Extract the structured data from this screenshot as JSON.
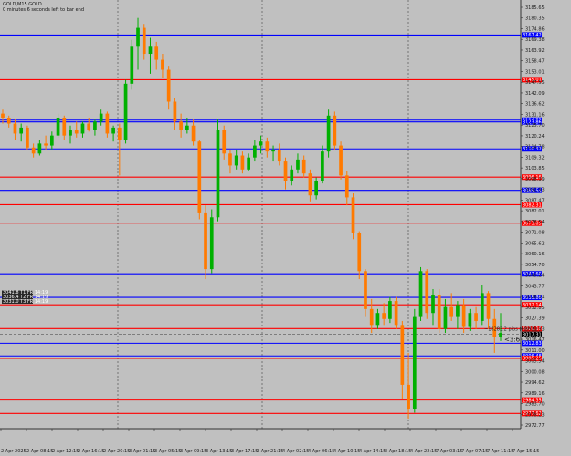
{
  "window": {
    "symbol_header": "GOLD,M15  GOLD",
    "timer_text": "0 minutes 6 seconds left to bar end"
  },
  "chart_data": {
    "type": "candlestick",
    "symbol": "GOLD",
    "timeframe": "M15",
    "ylim": [
      2970,
      3185
    ],
    "y_ticks": [
      3180.65,
      3172.9,
      3164.78,
      3156.57,
      3148.3,
      3139.9,
      3131.71,
      3122.22,
      3116.71,
      3111.25,
      3105.79,
      3100.3,
      3094.95,
      3089.46,
      3083.95,
      3078.49,
      3073.04,
      3067.57,
      3062.07,
      3056.58,
      3051.12,
      3045.61,
      3040.27,
      3034.73,
      3029.27,
      3023.89,
      3018.4,
      3012.92,
      3007.46,
      3001.98,
      2996.59,
      2991.11,
      2985.61,
      2979.75
    ],
    "y_tick_labels": [
      "3185.65",
      "3180.35",
      "3174.86",
      "3169.38",
      "3163.92",
      "3158.47",
      "3153.01",
      "3147.55",
      "3142.09",
      "3136.62",
      "3131.16",
      "3125.70",
      "3120.24",
      "3114.78",
      "3109.32",
      "3103.85",
      "3098.39",
      "3092.93",
      "3087.47",
      "3082.01",
      "3076.54",
      "3071.08",
      "3065.62",
      "3060.16",
      "3054.70",
      "3049.24",
      "3043.77",
      "3038.31",
      "3032.85",
      "3027.39",
      "3021.93",
      "3016.47",
      "3011.00",
      "3005.54",
      "3000.08",
      "2994.62",
      "2989.16",
      "2983.70",
      "2978.23",
      "2972.77"
    ],
    "x_tick_labels": [
      "2 Apr 2025",
      "2 Apr 08:15",
      "2 Apr 12:15",
      "2 Apr 16:15",
      "2 Apr 20:15",
      "3 Apr 01:15",
      "3 Apr 05:15",
      "3 Apr 09:15",
      "3 Apr 13:15",
      "3 Apr 17:15",
      "3 Apr 21:15",
      "4 Apr 02:15",
      "4 Apr 06:15",
      "4 Apr 10:15",
      "4 Apr 14:15",
      "4 Apr 18:15",
      "4 Apr 22:15",
      "7 Apr 03:15",
      "7 Apr 07:15",
      "7 Apr 11:15",
      "7 Apr 15:15"
    ],
    "period_separators": [
      "3 Apr 00:00",
      "4 Apr 00:00",
      "7 Apr 00:00"
    ],
    "levels": [
      {
        "price": 3167.42,
        "color": "#0000ff",
        "label": "3167.42"
      },
      {
        "price": 3145.01,
        "color": "#ff0000",
        "label": "3145.01"
      },
      {
        "price": 3124.73,
        "color": "#0000ff",
        "label": "3124.73"
      },
      {
        "price": 3123.86,
        "color": "#0000ff",
        "label": "3123.86"
      },
      {
        "price": 3110.32,
        "color": "#0000ff",
        "label": "3110.32"
      },
      {
        "price": 3096.16,
        "color": "#ff0000",
        "label": "3096.16"
      },
      {
        "price": 3089.54,
        "color": "#0000ff",
        "label": "3089.54"
      },
      {
        "price": 3082.31,
        "color": "#ff0000",
        "label": "3082.31"
      },
      {
        "price": 3073.05,
        "color": "#ff0000",
        "label": "3073.05"
      },
      {
        "price": 3047.66,
        "color": "#0000ff",
        "label": "3047.66"
      },
      {
        "price": 3035.86,
        "color": "#0000ff",
        "label": "3035.86"
      },
      {
        "price": 3032.14,
        "color": "#ff0000",
        "label": "3032.14"
      },
      {
        "price": 3020.16,
        "color": "#ff0000",
        "label": "3020.16"
      },
      {
        "price": 3012.83,
        "color": "#0000ff",
        "label": "3012.83"
      },
      {
        "price": 3006.48,
        "color": "#0000ff",
        "label": "3006.48"
      },
      {
        "price": 3005.25,
        "color": "#ff0000",
        "label": "3005.25"
      },
      {
        "price": 2984.35,
        "color": "#ff0000",
        "label": "2984.35"
      },
      {
        "price": 2977.62,
        "color": "#ff0000",
        "label": "2977.62"
      }
    ],
    "current_price": {
      "price": 3017.31,
      "label": "3017.31"
    },
    "price_line_annotation": "~18283.2 pips (68.5%)",
    "cursor_label": "<3:6",
    "left_tags": [
      "3041.8 T1 FR 14:19",
      "3036.4 T2 FR 14:19",
      "3031.0 T3 FR 14:19"
    ],
    "colors": {
      "background": "#c0c0c0",
      "bull": "#00b000",
      "bear": "#ff7a00",
      "wick": "#333333",
      "grid": "#808080"
    },
    "candles": [
      {
        "t": 0,
        "o": 3128,
        "h": 3130,
        "l": 3123,
        "c": 3126
      },
      {
        "t": 1,
        "o": 3126,
        "h": 3127,
        "l": 3121,
        "c": 3123
      },
      {
        "t": 2,
        "o": 3123,
        "h": 3125,
        "l": 3115,
        "c": 3118
      },
      {
        "t": 3,
        "o": 3118,
        "h": 3123,
        "l": 3114,
        "c": 3121
      },
      {
        "t": 4,
        "o": 3121,
        "h": 3122,
        "l": 3110,
        "c": 3111
      },
      {
        "t": 5,
        "o": 3111,
        "h": 3113,
        "l": 3106,
        "c": 3108
      },
      {
        "t": 6,
        "o": 3108,
        "h": 3115,
        "l": 3107,
        "c": 3113
      },
      {
        "t": 7,
        "o": 3113,
        "h": 3117,
        "l": 3110,
        "c": 3112
      },
      {
        "t": 8,
        "o": 3112,
        "h": 3119,
        "l": 3110,
        "c": 3117
      },
      {
        "t": 9,
        "o": 3117,
        "h": 3128,
        "l": 3116,
        "c": 3126
      },
      {
        "t": 10,
        "o": 3126,
        "h": 3127,
        "l": 3115,
        "c": 3117
      },
      {
        "t": 11,
        "o": 3117,
        "h": 3122,
        "l": 3113,
        "c": 3120
      },
      {
        "t": 12,
        "o": 3120,
        "h": 3124,
        "l": 3116,
        "c": 3118
      },
      {
        "t": 13,
        "o": 3118,
        "h": 3124,
        "l": 3116,
        "c": 3123
      },
      {
        "t": 14,
        "o": 3123,
        "h": 3126,
        "l": 3119,
        "c": 3120
      },
      {
        "t": 15,
        "o": 3120,
        "h": 3125,
        "l": 3117,
        "c": 3124
      },
      {
        "t": 16,
        "o": 3124,
        "h": 3130,
        "l": 3122,
        "c": 3128
      },
      {
        "t": 17,
        "o": 3128,
        "h": 3129,
        "l": 3116,
        "c": 3118
      },
      {
        "t": 18,
        "o": 3118,
        "h": 3122,
        "l": 3114,
        "c": 3121
      },
      {
        "t": 19,
        "o": 3121,
        "h": 3123,
        "l": 3097,
        "c": 3115
      },
      {
        "t": 20,
        "o": 3115,
        "h": 3145,
        "l": 3113,
        "c": 3143
      },
      {
        "t": 21,
        "o": 3143,
        "h": 3165,
        "l": 3140,
        "c": 3162
      },
      {
        "t": 22,
        "o": 3162,
        "h": 3176,
        "l": 3150,
        "c": 3171
      },
      {
        "t": 23,
        "o": 3171,
        "h": 3173,
        "l": 3155,
        "c": 3158
      },
      {
        "t": 24,
        "o": 3158,
        "h": 3166,
        "l": 3148,
        "c": 3162
      },
      {
        "t": 25,
        "o": 3162,
        "h": 3164,
        "l": 3150,
        "c": 3155
      },
      {
        "t": 26,
        "o": 3155,
        "h": 3158,
        "l": 3146,
        "c": 3150
      },
      {
        "t": 27,
        "o": 3150,
        "h": 3152,
        "l": 3130,
        "c": 3134
      },
      {
        "t": 28,
        "o": 3134,
        "h": 3136,
        "l": 3120,
        "c": 3124
      },
      {
        "t": 29,
        "o": 3124,
        "h": 3128,
        "l": 3116,
        "c": 3120
      },
      {
        "t": 30,
        "o": 3120,
        "h": 3126,
        "l": 3118,
        "c": 3122
      },
      {
        "t": 31,
        "o": 3122,
        "h": 3125,
        "l": 3112,
        "c": 3114
      },
      {
        "t": 32,
        "o": 3114,
        "h": 3115,
        "l": 3075,
        "c": 3078
      },
      {
        "t": 33,
        "o": 3078,
        "h": 3082,
        "l": 3045,
        "c": 3050
      },
      {
        "t": 34,
        "o": 3050,
        "h": 3080,
        "l": 3048,
        "c": 3076
      },
      {
        "t": 35,
        "o": 3076,
        "h": 3125,
        "l": 3074,
        "c": 3120
      },
      {
        "t": 36,
        "o": 3120,
        "h": 3122,
        "l": 3105,
        "c": 3108
      },
      {
        "t": 37,
        "o": 3108,
        "h": 3110,
        "l": 3098,
        "c": 3102
      },
      {
        "t": 38,
        "o": 3102,
        "h": 3110,
        "l": 3100,
        "c": 3107
      },
      {
        "t": 39,
        "o": 3107,
        "h": 3109,
        "l": 3098,
        "c": 3100
      },
      {
        "t": 40,
        "o": 3100,
        "h": 3108,
        "l": 3099,
        "c": 3106
      },
      {
        "t": 41,
        "o": 3106,
        "h": 3115,
        "l": 3104,
        "c": 3112
      },
      {
        "t": 42,
        "o": 3112,
        "h": 3117,
        "l": 3108,
        "c": 3114
      },
      {
        "t": 43,
        "o": 3114,
        "h": 3116,
        "l": 3106,
        "c": 3109
      },
      {
        "t": 44,
        "o": 3109,
        "h": 3112,
        "l": 3104,
        "c": 3110
      },
      {
        "t": 45,
        "o": 3110,
        "h": 3113,
        "l": 3102,
        "c": 3104
      },
      {
        "t": 46,
        "o": 3104,
        "h": 3106,
        "l": 3090,
        "c": 3094
      },
      {
        "t": 47,
        "o": 3094,
        "h": 3102,
        "l": 3092,
        "c": 3100
      },
      {
        "t": 48,
        "o": 3100,
        "h": 3108,
        "l": 3098,
        "c": 3105
      },
      {
        "t": 49,
        "o": 3105,
        "h": 3107,
        "l": 3096,
        "c": 3098
      },
      {
        "t": 50,
        "o": 3098,
        "h": 3100,
        "l": 3084,
        "c": 3087
      },
      {
        "t": 51,
        "o": 3087,
        "h": 3096,
        "l": 3085,
        "c": 3094
      },
      {
        "t": 52,
        "o": 3094,
        "h": 3112,
        "l": 3093,
        "c": 3109
      },
      {
        "t": 53,
        "o": 3109,
        "h": 3130,
        "l": 3106,
        "c": 3127
      },
      {
        "t": 54,
        "o": 3127,
        "h": 3129,
        "l": 3110,
        "c": 3112
      },
      {
        "t": 55,
        "o": 3112,
        "h": 3114,
        "l": 3095,
        "c": 3097
      },
      {
        "t": 56,
        "o": 3097,
        "h": 3099,
        "l": 3082,
        "c": 3086
      },
      {
        "t": 57,
        "o": 3086,
        "h": 3088,
        "l": 3065,
        "c": 3068
      },
      {
        "t": 58,
        "o": 3068,
        "h": 3069,
        "l": 3045,
        "c": 3049
      },
      {
        "t": 59,
        "o": 3049,
        "h": 3050,
        "l": 3026,
        "c": 3030
      },
      {
        "t": 60,
        "o": 3030,
        "h": 3035,
        "l": 3018,
        "c": 3022
      },
      {
        "t": 61,
        "o": 3022,
        "h": 3030,
        "l": 3020,
        "c": 3028
      },
      {
        "t": 62,
        "o": 3028,
        "h": 3033,
        "l": 3022,
        "c": 3025
      },
      {
        "t": 63,
        "o": 3025,
        "h": 3036,
        "l": 3023,
        "c": 3034
      },
      {
        "t": 64,
        "o": 3034,
        "h": 3036,
        "l": 3020,
        "c": 3022
      },
      {
        "t": 65,
        "o": 3022,
        "h": 3024,
        "l": 2985,
        "c": 2992
      },
      {
        "t": 66,
        "o": 2992,
        "h": 3008,
        "l": 2975,
        "c": 2980
      },
      {
        "t": 67,
        "o": 2980,
        "h": 3030,
        "l": 2978,
        "c": 3026
      },
      {
        "t": 68,
        "o": 3026,
        "h": 3051,
        "l": 3024,
        "c": 3049
      },
      {
        "t": 69,
        "o": 3049,
        "h": 3050,
        "l": 3025,
        "c": 3028
      },
      {
        "t": 70,
        "o": 3028,
        "h": 3040,
        "l": 3022,
        "c": 3037
      },
      {
        "t": 71,
        "o": 3037,
        "h": 3040,
        "l": 3018,
        "c": 3020
      },
      {
        "t": 72,
        "o": 3020,
        "h": 3035,
        "l": 3018,
        "c": 3031
      },
      {
        "t": 73,
        "o": 3031,
        "h": 3038,
        "l": 3024,
        "c": 3026
      },
      {
        "t": 74,
        "o": 3026,
        "h": 3034,
        "l": 3020,
        "c": 3032
      },
      {
        "t": 75,
        "o": 3032,
        "h": 3035,
        "l": 3018,
        "c": 3021
      },
      {
        "t": 76,
        "o": 3021,
        "h": 3030,
        "l": 3019,
        "c": 3028
      },
      {
        "t": 77,
        "o": 3028,
        "h": 3031,
        "l": 3020,
        "c": 3024
      },
      {
        "t": 78,
        "o": 3024,
        "h": 3042,
        "l": 3022,
        "c": 3038
      },
      {
        "t": 79,
        "o": 3038,
        "h": 3039,
        "l": 3020,
        "c": 3025
      },
      {
        "t": 80,
        "o": 3025,
        "h": 3030,
        "l": 3008,
        "c": 3016
      },
      {
        "t": 81,
        "o": 3016,
        "h": 3028,
        "l": 3014,
        "c": 3018
      }
    ]
  }
}
